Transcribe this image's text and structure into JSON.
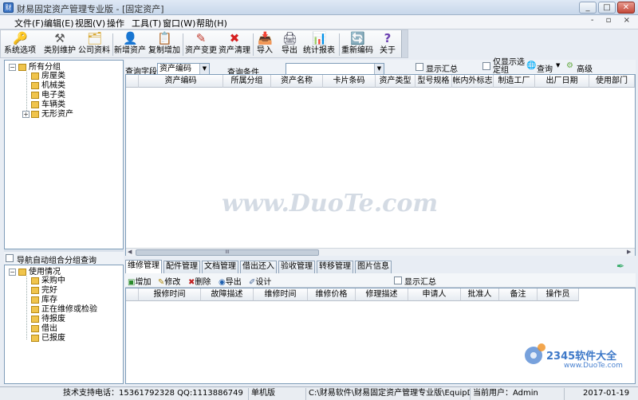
{
  "window": {
    "title": "财易固定资产管理专业版 - [固定资产]",
    "minimize": "_",
    "restore": "□",
    "close": "✕",
    "mdi_controls": "- ▫ ×"
  },
  "menu": [
    "文件(F)",
    "编辑(E)",
    "视图(V)",
    "操作",
    "工具(T)",
    "窗口(W)",
    "帮助(H)"
  ],
  "toolbar": [
    {
      "label": "系统选项",
      "icon": "key-icon",
      "glyph": "🔑"
    },
    {
      "label": "类别维护",
      "icon": "tools-icon",
      "glyph": "⚒"
    },
    {
      "label": "公司资料",
      "icon": "company-icon",
      "glyph": "🗂"
    },
    {
      "label": "新增资产",
      "icon": "add-asset-icon",
      "glyph": "👤"
    },
    {
      "label": "复制增加",
      "icon": "copy-icon",
      "glyph": "📋"
    },
    {
      "label": "资产变更",
      "icon": "pencil-icon",
      "glyph": "✎"
    },
    {
      "label": "资产清理",
      "icon": "delete-x-icon",
      "glyph": "✖"
    },
    {
      "label": "导入",
      "icon": "import-icon",
      "glyph": "📥"
    },
    {
      "label": "导出",
      "icon": "export-icon",
      "glyph": "🖨"
    },
    {
      "label": "统计报表",
      "icon": "chart-icon",
      "glyph": "📊"
    },
    {
      "label": "重新编码",
      "icon": "recode-icon",
      "glyph": "🔄"
    },
    {
      "label": "关于",
      "icon": "help-icon",
      "glyph": "?"
    }
  ],
  "category_tree": {
    "root": "所有分组",
    "children": [
      "房屋类",
      "机械类",
      "电子类",
      "车辆类",
      "无形资产"
    ]
  },
  "nav_checkbox_label": "导航自动组合分组查询",
  "usage_tree": {
    "root": "使用情况",
    "children": [
      "采购中",
      "完好",
      "库存",
      "正在维修或检验",
      "待报废",
      "借出",
      "已报废"
    ]
  },
  "query": {
    "field_label": "查询字段",
    "field_value": "资产编码",
    "condition_label": "查询条件",
    "condition_value": "",
    "show_summary": "显示汇总",
    "show_selected": "仅显示选定组",
    "query_button": "查询",
    "advanced_button": "高级"
  },
  "main_columns": [
    "资产编码",
    "所属分组",
    "资产名称",
    "卡片条码",
    "资产类型",
    "型号规格",
    "帐内外标志",
    "制造工厂",
    "出厂日期",
    "使用部门"
  ],
  "scroll_marker": "III",
  "tabs": [
    "维修管理",
    "配件管理",
    "文档管理",
    "借出还入",
    "验收管理",
    "转移管理",
    "图片信息"
  ],
  "sub_toolbar": {
    "add": "增加",
    "edit": "修改",
    "delete": "删除",
    "export": "导出",
    "design": "设计",
    "show_summary": "显示汇总"
  },
  "sub_columns": [
    "报修时间",
    "故障描述",
    "维修时间",
    "维修价格",
    "修理描述",
    "申请人",
    "批准人",
    "备注",
    "操作员"
  ],
  "watermark": "www.DuoTe.com",
  "corner_logo": {
    "brand": "2345软件大全",
    "url": "www.DuoTe.com"
  },
  "status": {
    "support": "技术支持电话：15361792328 QQ:1113886749",
    "edition": "单机版",
    "path": "C:\\财易软件\\财易固定资产管理专业版\\EquipData.sys",
    "user": "当前用户：Admin",
    "date": "2017-01-19"
  },
  "colors": {
    "folder": "#f0c44c",
    "accent": "#3a73c4"
  }
}
